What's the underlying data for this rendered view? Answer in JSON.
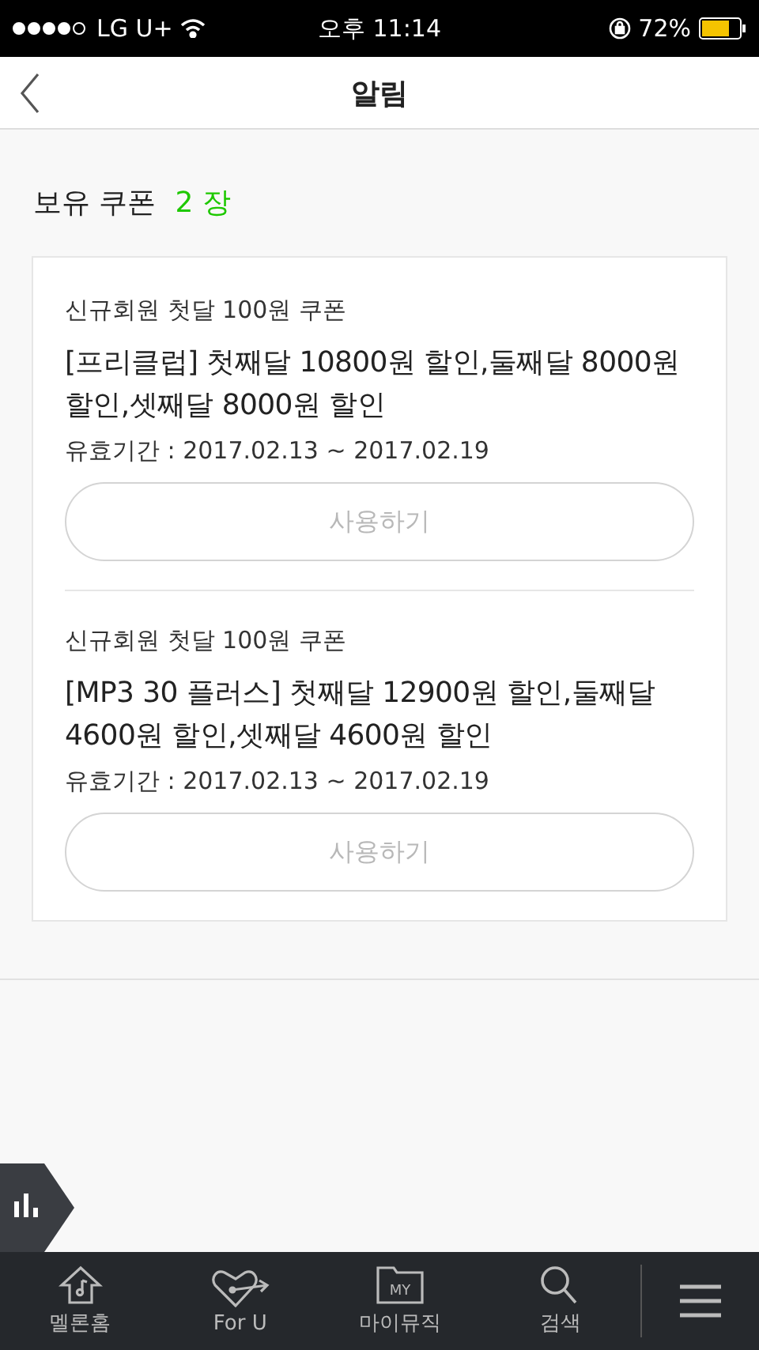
{
  "status_bar": {
    "carrier": "LG U+",
    "time": "오후 11:14",
    "battery": "72%"
  },
  "header": {
    "title": "알림"
  },
  "summary": {
    "label": "보유 쿠폰",
    "count": "2 장"
  },
  "coupons": [
    {
      "name": "신규회원 첫달 100원 쿠폰",
      "title": "[프리클럽] 첫째달 10800원 할인,둘째달 8000원 할인,셋째달 8000원 할인",
      "validity": "유효기간 : 2017.02.13 ~ 2017.02.19",
      "button": "사용하기",
      "disabled": true
    },
    {
      "name": "신규회원 첫달 100원 쿠폰",
      "title": "[MP3 30 플러스] 첫째달 12900원 할인,둘째달 4600원 할인,셋째달 4600원 할인",
      "validity": "유효기간 : 2017.02.13 ~ 2017.02.19",
      "button": "사용하기",
      "disabled": true
    }
  ],
  "tab_bar": [
    {
      "kind": "home",
      "label": "멜론홈"
    },
    {
      "kind": "heart",
      "label": "For U"
    },
    {
      "kind": "folder",
      "label": "마이뮤직",
      "badge": "MY"
    },
    {
      "kind": "search",
      "label": "검색"
    }
  ]
}
